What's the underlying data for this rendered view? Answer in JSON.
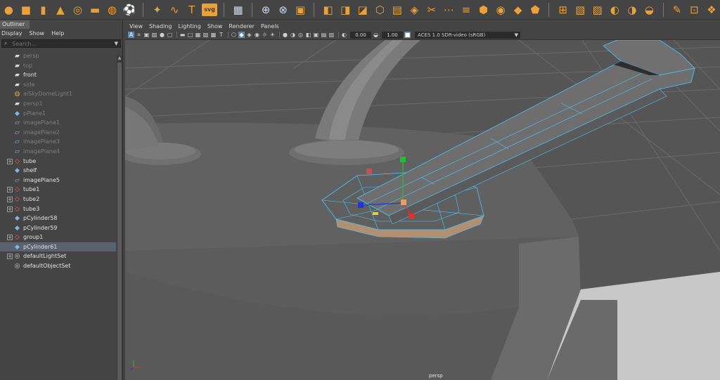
{
  "shelf": {
    "icons": [
      "sphere-icon",
      "cube-icon",
      "cylinder-icon",
      "cone-icon",
      "torus-icon",
      "plane-icon",
      "disc-icon",
      "soccer-ball-icon",
      "star-sparkle-icon",
      "helix-icon",
      "text-icon",
      "svg-icon",
      "grid-icon",
      "center-pivot-icon",
      "freeze-transform-icon",
      "combine-icon",
      "separate-icon",
      "extract-icon",
      "bevel-icon",
      "bridge-icon",
      "extrude-icon",
      "fill-hole-icon",
      "multi-cut-icon",
      "insert-edge-loop-icon",
      "offset-edge-loop-icon",
      "append-polygon-icon",
      "smooth-icon",
      "reduce-icon",
      "mirror-icon",
      "uv-editor-icon",
      "planar-map-icon",
      "cylindrical-map-icon",
      "spherical-map-icon",
      "auto-map-icon",
      "unfold-icon",
      "brush-icon",
      "crop-icon",
      "extra-icon"
    ],
    "svg_label": "svg",
    "text_label": "T",
    "accent": "#e9a23b"
  },
  "outliner": {
    "tab_label": "Outliner",
    "menu": [
      "Display",
      "Show",
      "Help"
    ],
    "search_placeholder": "Search...",
    "items": [
      {
        "label": "persp",
        "icon": "camera-icon",
        "dim": true,
        "expand": false
      },
      {
        "label": "top",
        "icon": "camera-icon",
        "dim": true,
        "expand": false
      },
      {
        "label": "front",
        "icon": "camera-icon",
        "dim": false,
        "expand": false
      },
      {
        "label": "side",
        "icon": "camera-icon",
        "dim": true,
        "expand": false
      },
      {
        "label": "aiSkyDomeLight1",
        "icon": "light-icon",
        "dim": true,
        "expand": false
      },
      {
        "label": "persp1",
        "icon": "camera-icon",
        "dim": true,
        "expand": false
      },
      {
        "label": "pPlane1",
        "icon": "mesh-icon",
        "dim": true,
        "expand": false
      },
      {
        "label": "imagePlane1",
        "icon": "image-plane-icon",
        "dim": true,
        "expand": false
      },
      {
        "label": "imagePlane2",
        "icon": "image-plane-icon",
        "dim": true,
        "expand": false
      },
      {
        "label": "imagePlane3",
        "icon": "image-plane-icon",
        "dim": true,
        "expand": false
      },
      {
        "label": "imagePlane4",
        "icon": "image-plane-icon",
        "dim": true,
        "expand": false
      },
      {
        "label": "tube",
        "icon": "group-icon",
        "dim": false,
        "expand": true
      },
      {
        "label": "shelf",
        "icon": "mesh-icon",
        "dim": false,
        "expand": false
      },
      {
        "label": "imagePlane5",
        "icon": "image-plane-icon",
        "dim": false,
        "expand": false
      },
      {
        "label": "tube1",
        "icon": "group-icon",
        "dim": false,
        "expand": true
      },
      {
        "label": "tube2",
        "icon": "group-icon",
        "dim": false,
        "expand": true
      },
      {
        "label": "tube3",
        "icon": "group-icon",
        "dim": false,
        "expand": true
      },
      {
        "label": "pCylinder58",
        "icon": "mesh-icon",
        "dim": false,
        "expand": false
      },
      {
        "label": "pCylinder59",
        "icon": "mesh-icon",
        "dim": false,
        "expand": false
      },
      {
        "label": "group1",
        "icon": "group-icon",
        "dim": false,
        "expand": true
      },
      {
        "label": "pCylinder61",
        "icon": "mesh-icon",
        "dim": false,
        "expand": false,
        "selected": true
      },
      {
        "label": "defaultLightSet",
        "icon": "set-icon",
        "dim": false,
        "expand": true
      },
      {
        "label": "defaultObjectSet",
        "icon": "set-icon",
        "dim": false,
        "expand": false
      }
    ]
  },
  "viewport": {
    "menu": [
      "View",
      "Shading",
      "Lighting",
      "Show",
      "Renderer",
      "Panels"
    ],
    "toolbar": {
      "near_value": "0.00",
      "far_value": "1.00",
      "color_management": "ACES 1.0 SDR-video (sRGB)"
    },
    "camera_label": "persp",
    "colors": {
      "background": "#545454",
      "wireframe": "#48c8ff",
      "manip_x": "#e03030",
      "manip_y": "#22c030",
      "manip_z": "#2233dd",
      "manip_center": "#e8a060"
    }
  }
}
